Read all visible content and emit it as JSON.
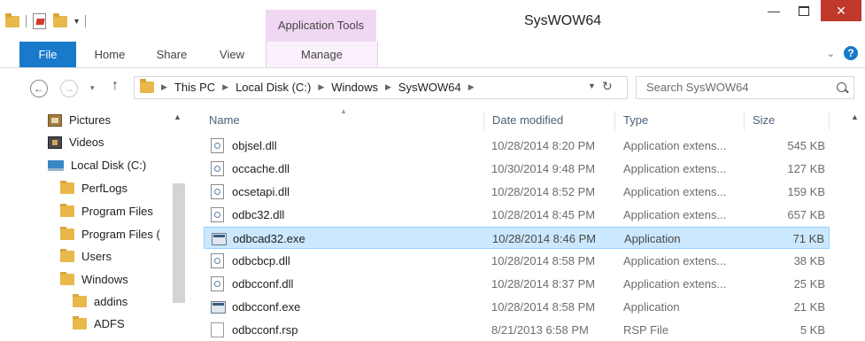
{
  "window": {
    "title": "SysWOW64",
    "context_tab_group": "Application Tools",
    "controls": {
      "minimize": "—",
      "close": "✕"
    }
  },
  "ribbon": {
    "tabs": [
      "File",
      "Home",
      "Share",
      "View",
      "Manage"
    ],
    "help": "?",
    "expand": "⌄"
  },
  "address": {
    "breadcrumbs": [
      "This PC",
      "Local Disk (C:)",
      "Windows",
      "SysWOW64"
    ],
    "search_placeholder": "Search SysWOW64"
  },
  "nav_pane": {
    "items": [
      {
        "label": "Pictures",
        "icon": "pictures-icon"
      },
      {
        "label": "Videos",
        "icon": "videos-icon"
      },
      {
        "label": "Local Disk (C:)",
        "icon": "disk-icon"
      },
      {
        "label": "PerfLogs",
        "icon": "folder-icon"
      },
      {
        "label": "Program Files",
        "icon": "folder-icon"
      },
      {
        "label": "Program Files (",
        "icon": "folder-icon"
      },
      {
        "label": "Users",
        "icon": "folder-icon"
      },
      {
        "label": "Windows",
        "icon": "folder-icon"
      },
      {
        "label": "addins",
        "icon": "folder-icon"
      },
      {
        "label": "ADFS",
        "icon": "folder-icon"
      }
    ]
  },
  "file_list": {
    "columns": [
      "Name",
      "Date modified",
      "Type",
      "Size"
    ],
    "rows": [
      {
        "name": "objsel.dll",
        "date": "10/28/2014 8:20 PM",
        "type": "Application extens...",
        "size": "545 KB",
        "icon": "dll-icon"
      },
      {
        "name": "occache.dll",
        "date": "10/30/2014 9:48 PM",
        "type": "Application extens...",
        "size": "127 KB",
        "icon": "dll-icon"
      },
      {
        "name": "ocsetapi.dll",
        "date": "10/28/2014 8:52 PM",
        "type": "Application extens...",
        "size": "159 KB",
        "icon": "dll-icon"
      },
      {
        "name": "odbc32.dll",
        "date": "10/28/2014 8:45 PM",
        "type": "Application extens...",
        "size": "657 KB",
        "icon": "dll-icon"
      },
      {
        "name": "odbcad32.exe",
        "date": "10/28/2014 8:46 PM",
        "type": "Application",
        "size": "71 KB",
        "icon": "exe-icon",
        "selected": true
      },
      {
        "name": "odbcbcp.dll",
        "date": "10/28/2014 8:58 PM",
        "type": "Application extens...",
        "size": "38 KB",
        "icon": "dll-icon"
      },
      {
        "name": "odbcconf.dll",
        "date": "10/28/2014 8:37 PM",
        "type": "Application extens...",
        "size": "25 KB",
        "icon": "dll-icon"
      },
      {
        "name": "odbcconf.exe",
        "date": "10/28/2014 8:58 PM",
        "type": "Application",
        "size": "21 KB",
        "icon": "exe-icon"
      },
      {
        "name": "odbcconf.rsp",
        "date": "8/21/2013 6:58 PM",
        "type": "RSP File",
        "size": "5 KB",
        "icon": "rsp-icon"
      }
    ]
  }
}
